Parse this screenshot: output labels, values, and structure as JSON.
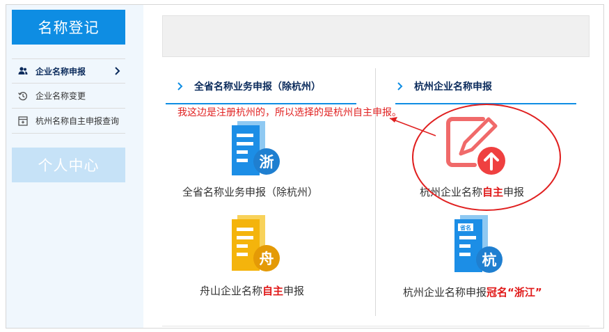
{
  "sidebar": {
    "title": "名称登记",
    "items": [
      {
        "label": "企业名称申报",
        "icon": "user-group-icon",
        "active": true
      },
      {
        "label": "企业名称变更",
        "icon": "history-icon",
        "active": false
      },
      {
        "label": "杭州名称自主申报查询",
        "icon": "search-box-icon",
        "active": false
      }
    ],
    "personal": "个人中心"
  },
  "sections": {
    "left_title": "全省名称业务申报（除杭州）",
    "right_title": "杭州企业名称申报"
  },
  "note": "我这边是注册杭州的，所以选择的是杭州自主申报。",
  "tiles": {
    "zhe": {
      "badge": "浙",
      "label": "全省名称业务申报（除杭州）"
    },
    "zhou": {
      "badge": "舟",
      "label_before": "舟山企业名称",
      "label_hl": "自主",
      "label_after": "申报"
    },
    "zizhu": {
      "label_before": "杭州企业名称",
      "label_hl": "自主",
      "label_after": "申报"
    },
    "hang": {
      "badge": "杭",
      "doc_tag": "省名",
      "label_before": "杭州企业名称申报",
      "label_hl": "冠名“浙江”"
    }
  },
  "colors": {
    "brand_blue": "#0e8de3",
    "note_red": "#e02020",
    "badge_yellow": "#f4b40c",
    "upload_red": "#ef4040"
  }
}
